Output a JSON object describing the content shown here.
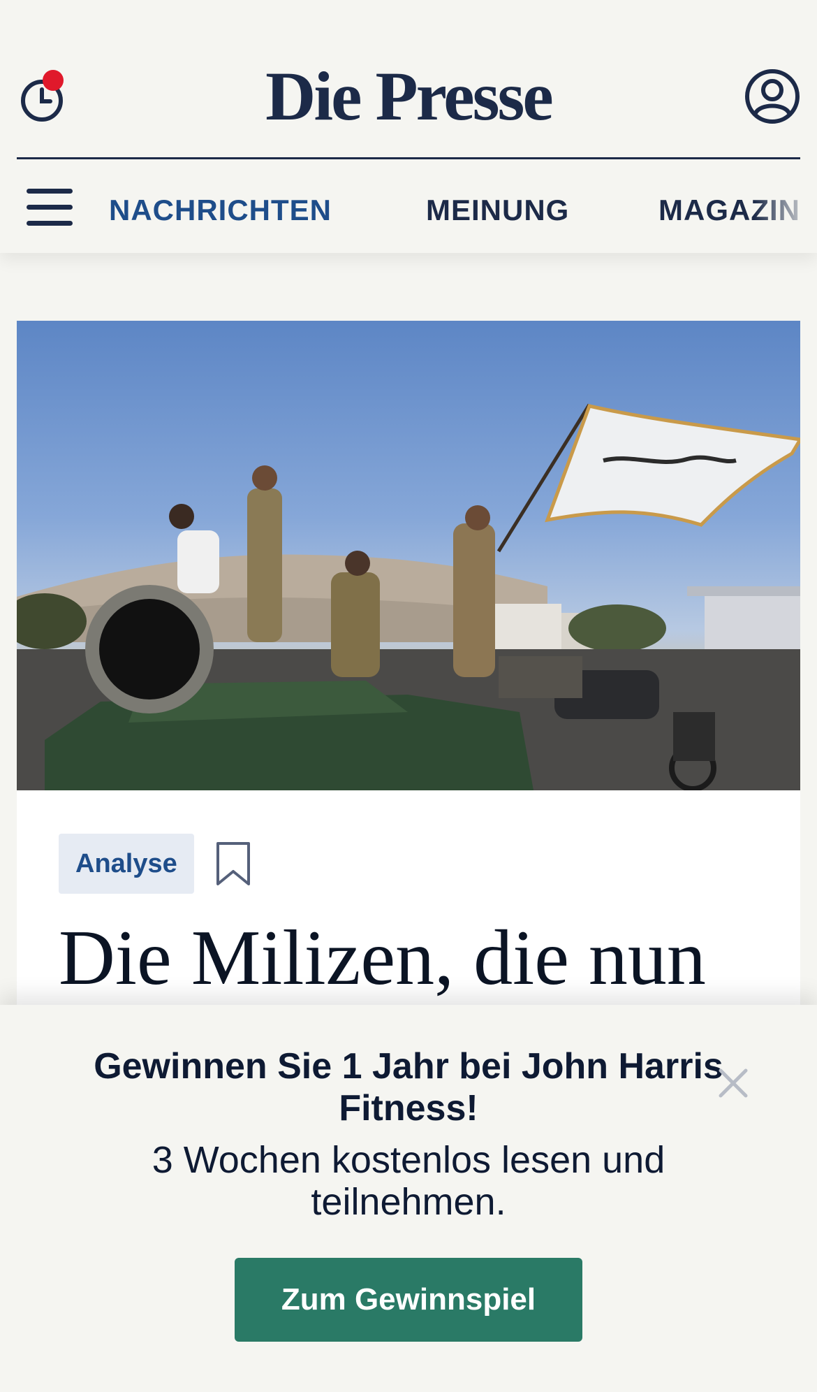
{
  "header": {
    "logo_text": "Die Presse",
    "history_icon": "clock-icon",
    "notification_dot_color": "#e0192b",
    "account_icon": "user-circle-icon",
    "brand_color": "#1c2a48"
  },
  "nav": {
    "menu_icon": "hamburger-menu-icon",
    "items": [
      {
        "label": "NACHRICHTEN",
        "active": true
      },
      {
        "label": "MEINUNG",
        "active": false
      },
      {
        "label": "MAGAZIN",
        "active": false
      }
    ],
    "active_color": "#1e4d8a"
  },
  "article": {
    "image_alt": "Fighters standing on a tank waving a flag",
    "tag": "Analyse",
    "bookmark_icon": "bookmark-icon",
    "headline": "Die Milizen, die nun"
  },
  "promo": {
    "title": "Gewinnen Sie 1 Jahr bei John Harris Fitness!",
    "subtitle": "3 Wochen kostenlos lesen und teilnehmen.",
    "cta_label": "Zum Gewinnspiel",
    "close_icon": "close-icon",
    "cta_color": "#2a7a66"
  }
}
